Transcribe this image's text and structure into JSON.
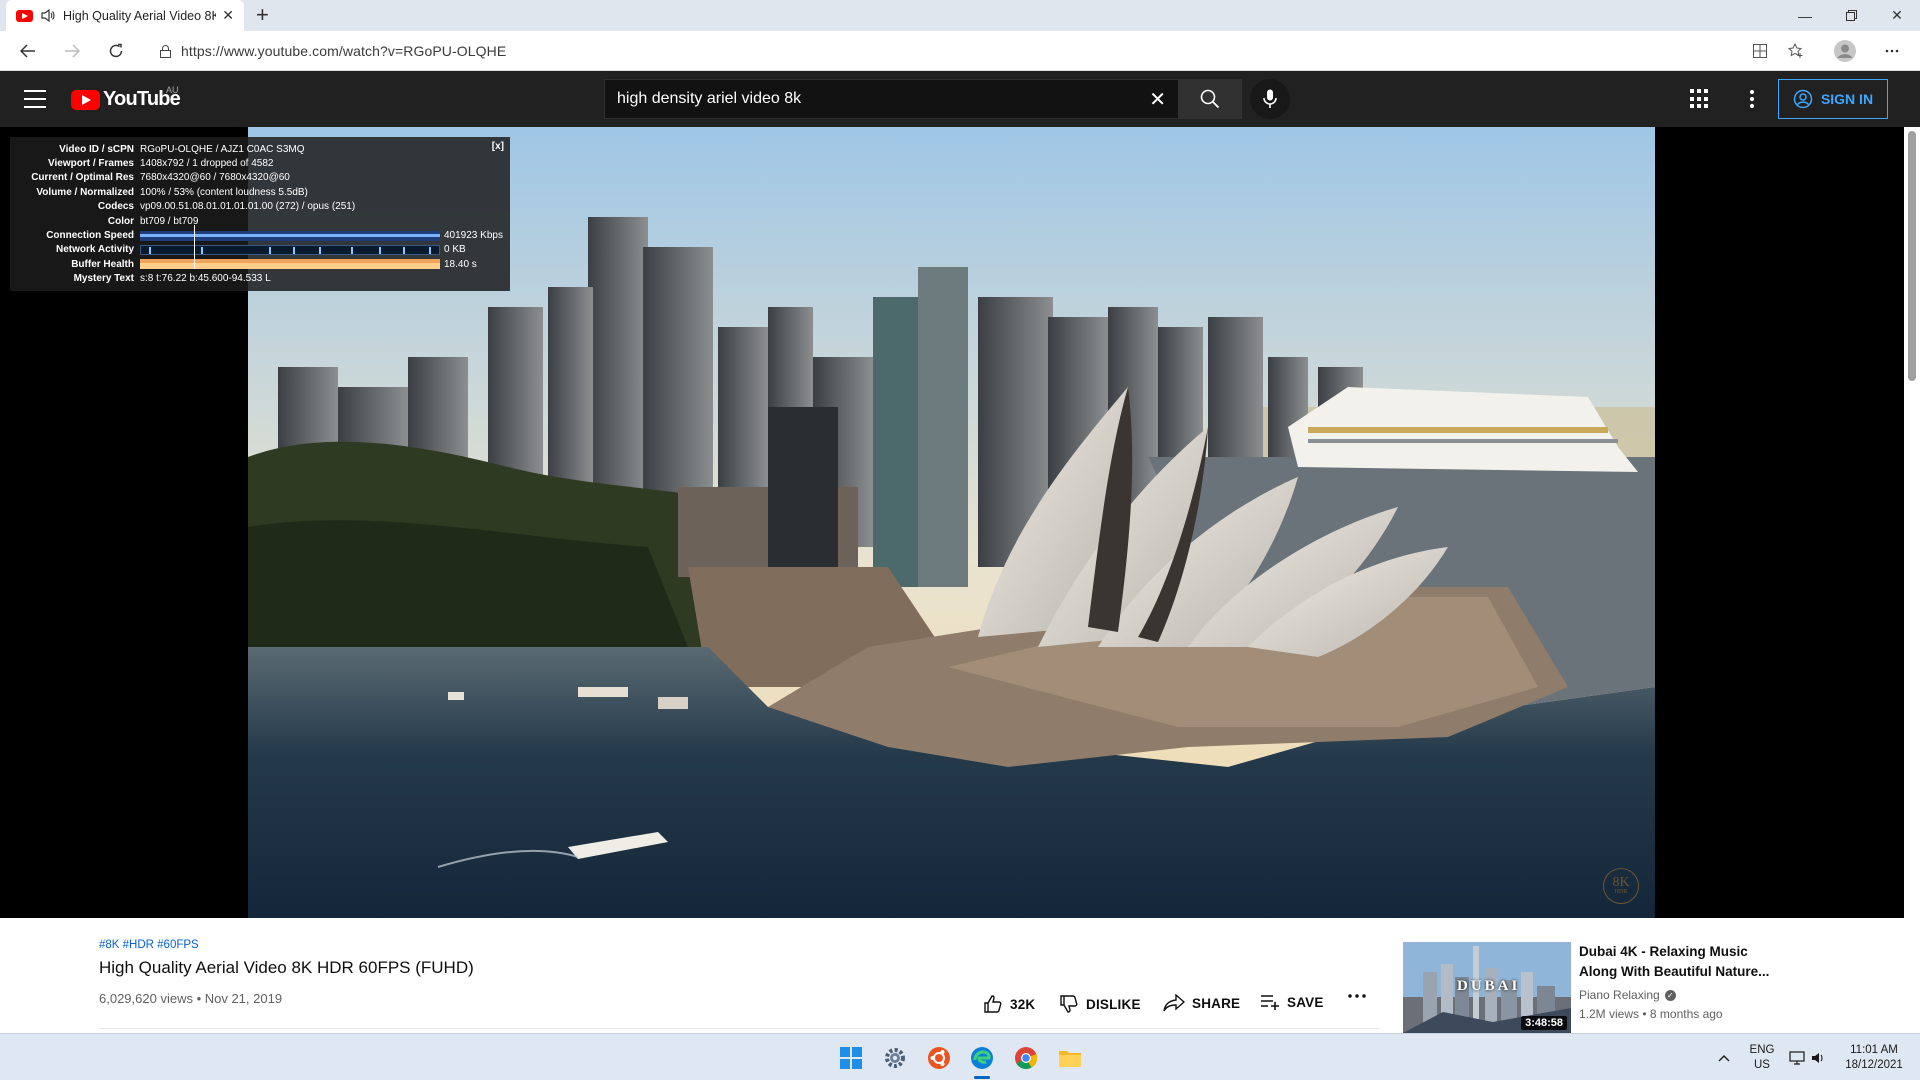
{
  "browser": {
    "tab_title": "High Quality Aerial Video 8K",
    "url": "https://www.youtube.com/watch?v=RGoPU-OLQHE"
  },
  "youtube": {
    "logo_text": "YouTube",
    "country": "AU",
    "search_query": "high density ariel video 8k",
    "sign_in_label": "SIGN IN"
  },
  "stats": {
    "rows": [
      {
        "label": "Video ID / sCPN",
        "value": "RGoPU-OLQHE / AJZ1 C0AC S3MQ"
      },
      {
        "label": "Viewport / Frames",
        "value": "1408x792 / 1 dropped of 4582"
      },
      {
        "label": "Current / Optimal Res",
        "value": "7680x4320@60 / 7680x4320@60"
      },
      {
        "label": "Volume / Normalized",
        "value": "100% / 53% (content loudness 5.5dB)"
      },
      {
        "label": "Codecs",
        "value": "vp09.00.51.08.01.01.01.01.00 (272) / opus (251)"
      },
      {
        "label": "Color",
        "value": "bt709 / bt709"
      }
    ],
    "connection_label": "Connection Speed",
    "connection_value": "401923 Kbps",
    "network_label": "Network Activity",
    "network_value": "0 KB",
    "buffer_label": "Buffer Health",
    "buffer_value": "18.40 s",
    "mystery_label": "Mystery Text",
    "mystery_value": "s:8 t:76.22 b:45.600-94.533 L",
    "close": "[x]"
  },
  "video": {
    "watermark_top": "8K",
    "watermark_bottom": "HDR",
    "hashtags": "#8K #HDR #60FPS",
    "title": "High Quality Aerial Video 8K HDR 60FPS (FUHD)",
    "meta": "6,029,620 views • Nov 21, 2019",
    "actions": {
      "like": "32K",
      "dislike": "DISLIKE",
      "share": "SHARE",
      "save": "SAVE"
    }
  },
  "recommendation": {
    "title": "Dubai 4K - Relaxing Music Along With Beautiful Nature...",
    "channel": "Piano Relaxing",
    "meta": "1.2M views • 8 months ago",
    "duration": "3:48:58",
    "thumb_text": "DUBAI"
  },
  "taskbar": {
    "lang_top": "ENG",
    "lang_bottom": "US",
    "time": "11:01 AM",
    "date": "18/12/2021"
  },
  "colors": {
    "accent_blue": "#3ea6ff",
    "youtube_red": "#ff0000",
    "masthead": "#212121"
  }
}
